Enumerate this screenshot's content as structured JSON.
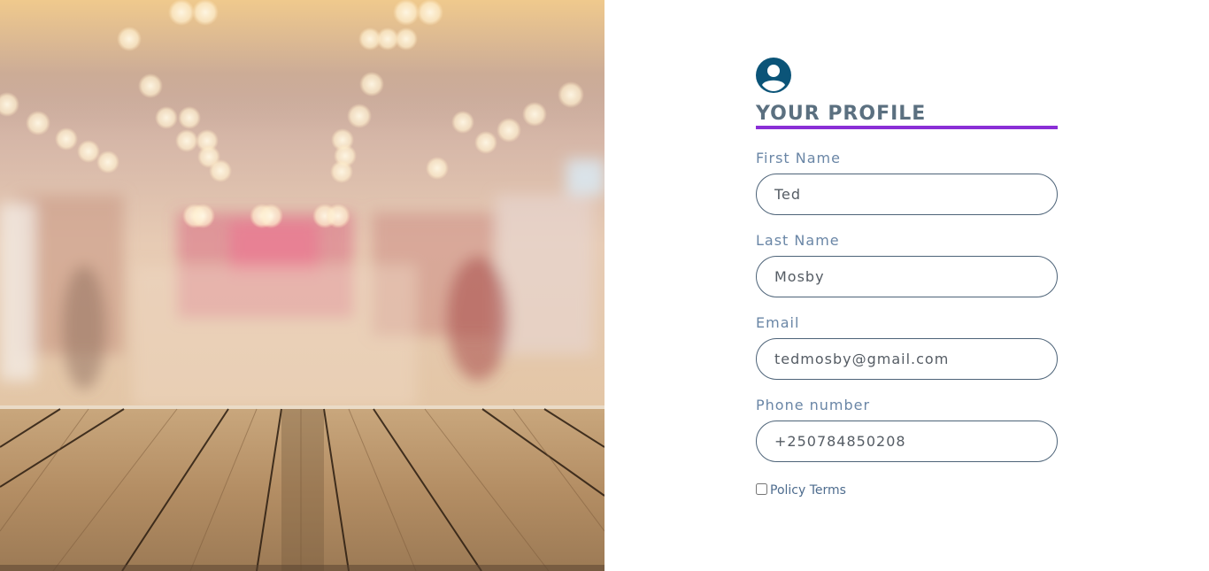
{
  "hero": {
    "image_name": "blurred-store-with-wooden-table"
  },
  "profile": {
    "avatar_icon": "user-circle-icon",
    "title": "YOUR PROFILE",
    "accent_color": "#8a2fd6",
    "fields": [
      {
        "label": "First Name",
        "value": "Ted"
      },
      {
        "label": "Last Name",
        "value": "Mosby"
      },
      {
        "label": "Email",
        "value": "tedmosby@gmail.com"
      },
      {
        "label": "Phone number",
        "value": "+250784850208"
      }
    ],
    "policy": {
      "label": "Policy Terms",
      "checked": false
    }
  }
}
